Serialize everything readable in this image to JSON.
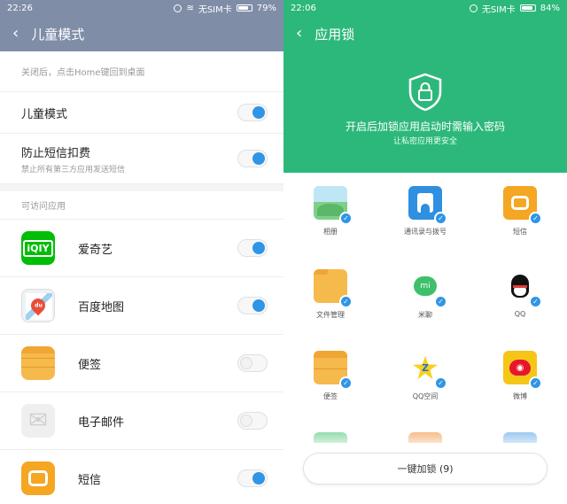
{
  "left": {
    "status": {
      "time": "22:26",
      "carrier": "无SIM卡",
      "battery": "79%",
      "battery_level": 0.79
    },
    "title": "儿童模式",
    "hint": "关闭后，点击Home键回到桌面",
    "settings": [
      {
        "label": "儿童模式",
        "sub": "",
        "on": true
      },
      {
        "label": "防止短信扣费",
        "sub": "禁止所有第三方应用发送短信",
        "on": true
      }
    ],
    "section": "可访问应用",
    "apps": [
      {
        "name": "爱奇艺",
        "icon": "iqiyi-icon",
        "color": "#00be06",
        "glyph": "iQIY",
        "on": true
      },
      {
        "name": "百度地图",
        "icon": "baidu-map-icon",
        "color": "#eef2f5",
        "glyph": "du",
        "on": true
      },
      {
        "name": "便签",
        "icon": "notes-icon",
        "color": "#f6b94b",
        "glyph": "",
        "on": false
      },
      {
        "name": "电子邮件",
        "icon": "email-icon",
        "color": "#efefef",
        "glyph": "✉",
        "on": false
      },
      {
        "name": "短信",
        "icon": "sms-icon",
        "color": "#f5a623",
        "glyph": "",
        "on": true
      }
    ]
  },
  "right": {
    "status": {
      "time": "22:06",
      "carrier": "无SIM卡",
      "battery": "84%",
      "battery_level": 0.84
    },
    "title": "应用锁",
    "message": "开启后加锁应用启动时需输入密码",
    "submessage": "让私密应用更安全",
    "apps": [
      {
        "name": "相册",
        "icon": "gallery-icon",
        "color": "#7fcf8a",
        "glyph": ""
      },
      {
        "name": "通讯录与拨号",
        "icon": "contacts-icon",
        "color": "#2f8fe0",
        "glyph": "👤"
      },
      {
        "name": "短信",
        "icon": "sms-icon",
        "color": "#f5a623",
        "glyph": ""
      },
      {
        "name": "文件管理",
        "icon": "file-manager-icon",
        "color": "#f6b94b",
        "glyph": ""
      },
      {
        "name": "米聊",
        "icon": "miliao-icon",
        "color": "#3ec06a",
        "glyph": "mi"
      },
      {
        "name": "QQ",
        "icon": "qq-icon",
        "color": "#ffffff",
        "glyph": "🐧"
      },
      {
        "name": "便签",
        "icon": "notes-icon",
        "color": "#f6b94b",
        "glyph": ""
      },
      {
        "name": "QQ空间",
        "icon": "qzone-icon",
        "color": "#f5d21e",
        "glyph": "Z"
      },
      {
        "name": "微博",
        "icon": "weibo-icon",
        "color": "#f5c518",
        "glyph": "◉"
      }
    ],
    "partial_colors": [
      "#3ec06a",
      "#f08a2c",
      "#4a9be0"
    ],
    "lock_button": "一键加锁 (9)"
  }
}
